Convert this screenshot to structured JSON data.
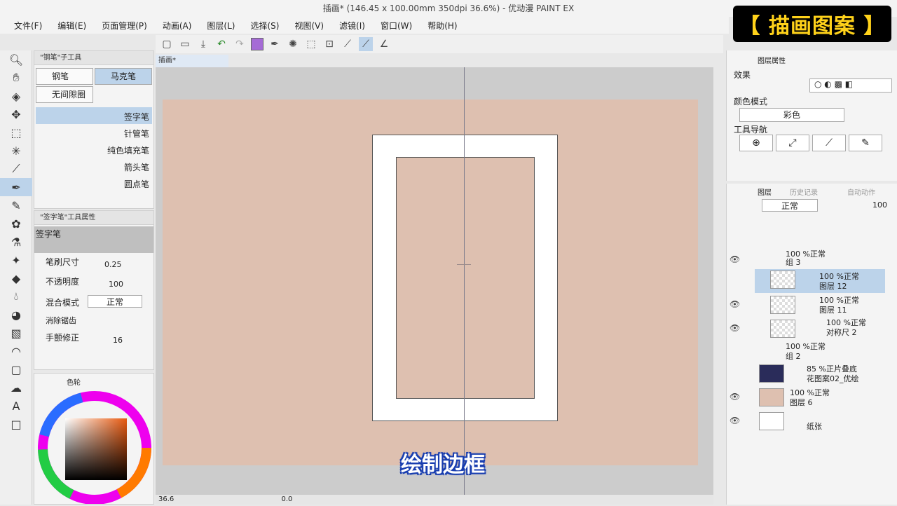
{
  "window": {
    "title": "插画* (146.45 x 100.00mm 350dpi 36.6%) - 优动漫 PAINT EX"
  },
  "menu": [
    "文件(F)",
    "编辑(E)",
    "页面管理(P)",
    "动画(A)",
    "图层(L)",
    "选择(S)",
    "视图(V)",
    "滤镜(I)",
    "窗口(W)",
    "帮助(H)"
  ],
  "brand": "【 描画图案 】",
  "subtitle": "绘制边框",
  "document_tab": "插画*",
  "subtool_panel": {
    "header": "\"钢笔\"子工具",
    "tabs": [
      "钢笔",
      "马克笔",
      "无间隙圈"
    ],
    "brushes": [
      "签字笔",
      "针管笔",
      "纯色填充笔",
      "箭头笔",
      "圆点笔"
    ]
  },
  "tool_property": {
    "header": "\"签字笔\"工具属性",
    "preset": "签字笔",
    "brush_size_label": "笔刷尺寸",
    "brush_size": "0.25",
    "opacity_label": "不透明度",
    "opacity": "100",
    "blend_label": "混合模式",
    "blend": "正常",
    "aa_label": "消除锯齿",
    "stab_label": "手颤修正",
    "stab": "16"
  },
  "color_panel": {
    "tab": "色轮"
  },
  "status": {
    "zoom": "36.6",
    "angle": "0.0"
  },
  "layer_property": {
    "tab": "图层属性",
    "effect_label": "效果",
    "color_mode_label": "颜色模式",
    "color_mode": "彩色",
    "tool_nav_label": "工具导航"
  },
  "layers_panel": {
    "tabs": [
      "图层",
      "历史记录",
      "自动动作"
    ],
    "blend": "正常",
    "opacity": "100",
    "layers": [
      {
        "pct": "100 %正常",
        "name": "组 3"
      },
      {
        "pct": "100 %正常",
        "name": "图层 12"
      },
      {
        "pct": "100 %正常",
        "name": "图层 11"
      },
      {
        "pct": "100 %正常",
        "name": "对称尺 2"
      },
      {
        "pct": "100 %正常",
        "name": "组 2"
      },
      {
        "pct": "85 %正片叠底",
        "name": "花图案02_优绘"
      },
      {
        "pct": "100 %正常",
        "name": "图层 6"
      },
      {
        "pct": "",
        "name": "纸张"
      }
    ]
  },
  "colors": {
    "paper": "#dec0b0",
    "accent": "#bcd3ea",
    "purple": "#a56bd6"
  }
}
